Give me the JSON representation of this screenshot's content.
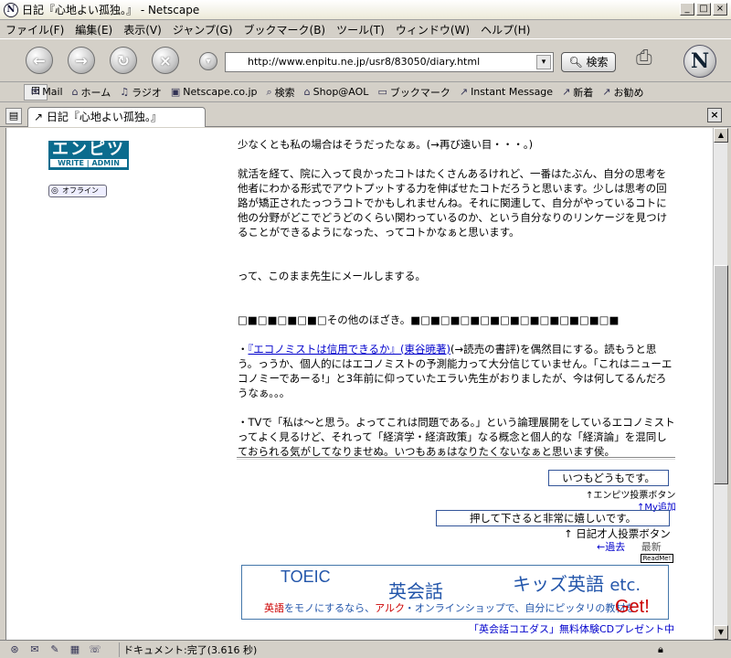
{
  "window": {
    "title": "日記『心地よい孤独。』 - Netscape",
    "btn_min": "_",
    "btn_max": "□",
    "btn_close": "×"
  },
  "menubar": {
    "items": [
      "ファイル(F)",
      "編集(E)",
      "表示(V)",
      "ジャンプ(G)",
      "ブックマーク(B)",
      "ツール(T)",
      "ウィンドウ(W)",
      "ヘルプ(H)"
    ]
  },
  "navbar": {
    "url": "http://www.enpitu.ne.jp/usr8/83050/diary.html",
    "search_label": "検索"
  },
  "personal_toolbar": {
    "items": [
      "Mail",
      "ホーム",
      "ラジオ",
      "Netscape.co.jp",
      "検索",
      "Shop@AOL",
      "ブックマーク",
      "Instant Message",
      "新着",
      "お勧め"
    ]
  },
  "tab": {
    "title": "日記『心地よい孤独。』"
  },
  "sidebar": {
    "logo_main": "エンピツ",
    "logo_write": "WRITE",
    "logo_admin": "ADMIN",
    "offline_label": "オフライン"
  },
  "diary": {
    "p1": "少なくとも私の場合はそうだったなぁ。(→再び遠い目・・・。)",
    "p2": "就活を経て、院に入って良かったコトはたくさんあるけれど、一番はたぶん、自分の思考を他者にわかる形式でアウトプットする力を伸ばせたコトだろうと思います。少しは思考の回路が矯正されたっつうコトでかもしれませんね。それに関連して、自分がやっているコトに他の分野がどこでどうどのくらい関わっているのか、という自分なりのリンケージを見つけることができるようになった、ってコトかなぁと思います。",
    "p3": "って、このまま先生にメールしまする。",
    "p4": "□■□■□■□■□その他のほざき。■□■□■□■□■□■□■□■□■□■□■",
    "p5_link": "『エコノミストは信用できるか』(東谷暁著)",
    "p5_prefix": "・",
    "p5_rest": "(→読売の書評)を偶然目にする。読もうと思う。っうか、個人的にはエコノミストの予測能力って大分信じていません。「これはニューエコノミーであーる!」と3年前に仰っていたエラい先生がおりましたが、今は何してるんだろうなぁ。。。",
    "p6": "・TVで「私は〜と思う。よってこれは問題である。」という論理展開をしているエコノミストってよく見るけど、それって「経済学・経済政策」なる概念と個人的な「経済論」を混同しておられる気がしてなりませぬ。いつもあぁはなりたくないなぁと思います侯。"
  },
  "footer": {
    "vote1_box": "いつもどうもです。",
    "vote1_caption": "↑エンピツ投票ボタン",
    "mylist": "↑My追加",
    "vote2_box": "押して下さると非常に嬉しいです。",
    "vote2_caption": "↑ 日記才人投票ボタン",
    "prev": "←過去",
    "latest": "最新",
    "readme": "ReadMe!"
  },
  "banner": {
    "toeic": "TOEIC",
    "eikaiwa": "英会話",
    "kids": "キッズ英語",
    "etc": "etc.",
    "tag_a": "英語",
    "tag_b": "をモノにするなら、",
    "tag_c": "アルク",
    "tag_d": "・オンラインショップで、自分にピッタリの教材を",
    "get": "Get!",
    "caption": "「英会話コエダス」無料体験CDプレゼント中"
  },
  "statusbar": {
    "text": "ドキュメント:完了(3.616 秒)"
  }
}
